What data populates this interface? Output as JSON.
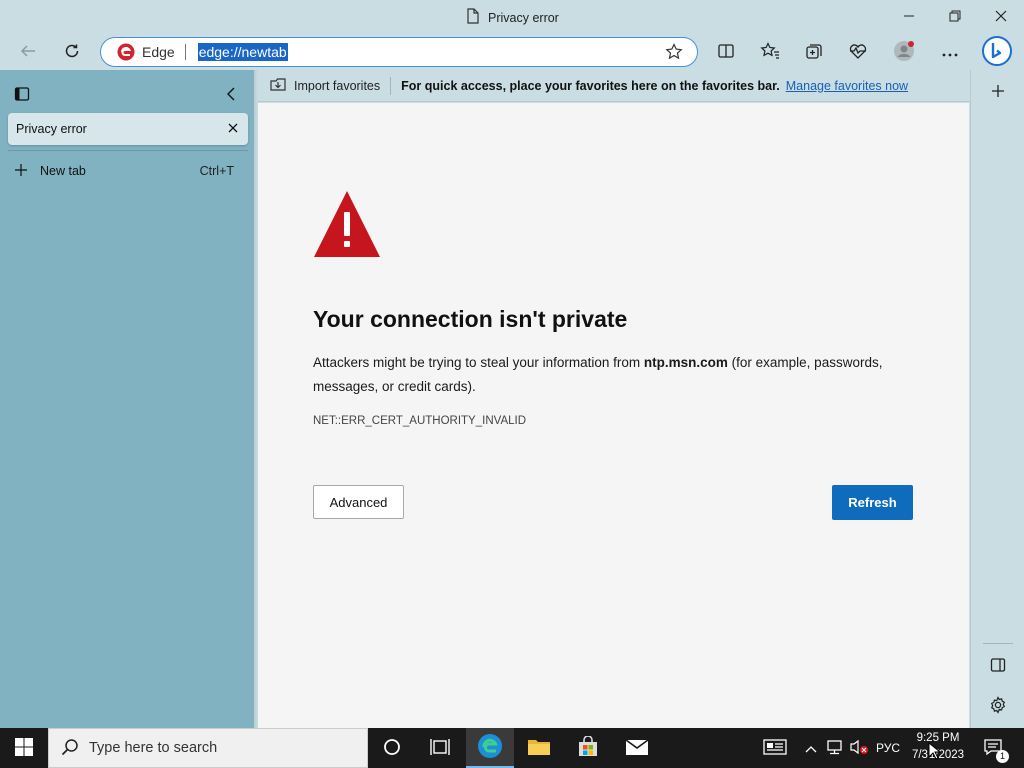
{
  "window": {
    "title": "Privacy error"
  },
  "toolbar": {
    "site_label": "Edge",
    "url": "edge://newtab"
  },
  "tabs_pane": {
    "tabs": [
      {
        "title": "Privacy error"
      }
    ],
    "new_tab_label": "New tab",
    "new_tab_shortcut": "Ctrl+T"
  },
  "favorites_bar": {
    "import_label": "Import favorites",
    "message": "For quick access, place your favorites here on the favorites bar.",
    "manage_link": "Manage favorites now"
  },
  "error_page": {
    "heading": "Your connection isn't private",
    "desc_prefix": "Attackers might be trying to steal your information from ",
    "desc_host": "ntp.msn.com",
    "desc_suffix": " (for example, passwords, messages, or credit cards).",
    "error_code": "NET::ERR_CERT_AUTHORITY_INVALID",
    "advanced_label": "Advanced",
    "refresh_label": "Refresh"
  },
  "taskbar": {
    "search_placeholder": "Type here to search",
    "language": "РУС",
    "time": "9:25 PM",
    "date": "7/3 1/2023",
    "notification_count": "1"
  },
  "colors": {
    "accent": "#0f6cbd",
    "warning": "#c4161c",
    "tab_pane": "#80b2c2",
    "chrome": "#c9dde3"
  }
}
